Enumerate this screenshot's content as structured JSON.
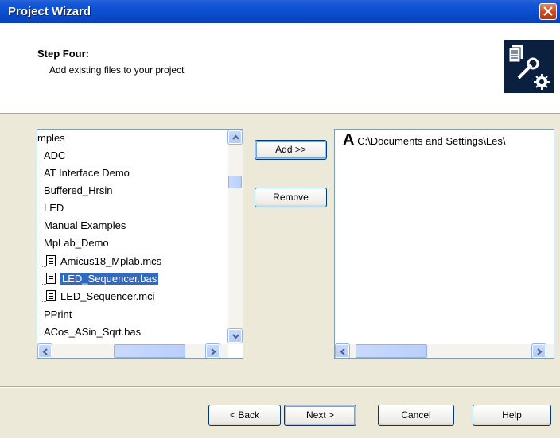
{
  "window": {
    "title": "Project Wizard"
  },
  "header": {
    "step_title": "Step Four:",
    "step_description": "Add existing files to your project"
  },
  "left_list": {
    "items": [
      {
        "label": "mples",
        "type": "folder",
        "selected": false
      },
      {
        "label": "ADC",
        "type": "folder",
        "selected": false
      },
      {
        "label": "AT Interface Demo",
        "type": "folder",
        "selected": false
      },
      {
        "label": "Buffered_Hrsin",
        "type": "folder",
        "selected": false
      },
      {
        "label": "LED",
        "type": "folder",
        "selected": false
      },
      {
        "label": "Manual Examples",
        "type": "folder",
        "selected": false
      },
      {
        "label": "MpLab_Demo",
        "type": "folder",
        "selected": false
      },
      {
        "label": "Amicus18_Mplab.mcs",
        "type": "file",
        "selected": false
      },
      {
        "label": "LED_Sequencer.bas",
        "type": "file",
        "selected": true
      },
      {
        "label": "LED_Sequencer.mci",
        "type": "file",
        "selected": false
      },
      {
        "label": "PPrint",
        "type": "folder",
        "selected": false
      },
      {
        "label": "ACos_ASin_Sqrt.bas",
        "type": "file",
        "selected": false
      }
    ]
  },
  "buttons": {
    "add": "Add >>",
    "remove": "Remove"
  },
  "right_list": {
    "items": [
      {
        "prefix": "A",
        "label": "C:\\Documents and Settings\\Les\\"
      }
    ]
  },
  "footer": {
    "back": "< Back",
    "next": "Next >",
    "cancel": "Cancel",
    "help": "Help"
  },
  "colors": {
    "title_bar": "#0b4fd1",
    "selection": "#316ac5",
    "dialog_bg": "#ece9d8"
  }
}
